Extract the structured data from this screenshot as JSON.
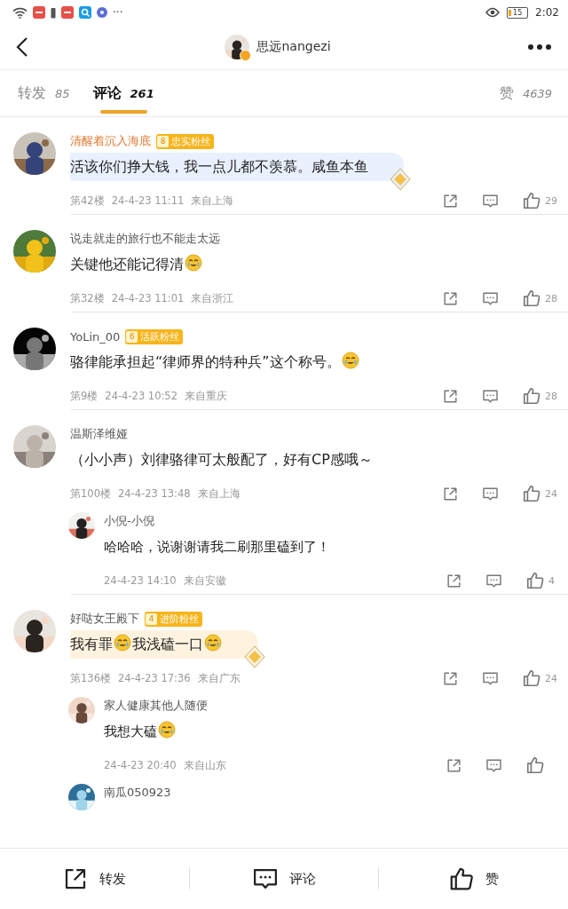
{
  "status_bar": {
    "more": "···",
    "battery": "15",
    "time": "2:02"
  },
  "header": {
    "title": "思远nangezi",
    "verified": true
  },
  "tabs": [
    {
      "label": "转发",
      "count": "85",
      "selected": false
    },
    {
      "label": "评论",
      "count": "261",
      "selected": true
    },
    {
      "label": "赞",
      "count": "4639",
      "selected": false
    }
  ],
  "comments": [
    {
      "kind": "comment",
      "name": "清醒着沉入海底",
      "vip": true,
      "badge": {
        "level": "8",
        "label": "忠实粉丝"
      },
      "color": "#e9f1ff",
      "content": [
        {
          "kind": "text",
          "text": "活该你们挣大钱，我一点儿都不羡慕。咸鱼本鱼"
        }
      ],
      "floor": "第42楼",
      "time": "24-4-23 11:11",
      "location": "来自上海",
      "likes": "29"
    },
    {
      "kind": "comment",
      "name": "说走就走的旅行也不能走太远",
      "vip": false,
      "content": [
        {
          "kind": "text",
          "text": "关键他还能记得清"
        },
        {
          "kind": "emoji"
        }
      ],
      "floor": "第32楼",
      "time": "24-4-23 11:01",
      "location": "来自浙江",
      "likes": "28"
    },
    {
      "kind": "comment",
      "name": "YoLin_00",
      "vip": false,
      "badge": {
        "level": "6",
        "label": "活跃粉丝"
      },
      "content": [
        {
          "kind": "text",
          "text": "骆律能承担起“律师界的特种兵”这个称号。"
        },
        {
          "kind": "emoji"
        }
      ],
      "floor": "第9楼",
      "time": "24-4-23 10:52",
      "location": "来自重庆",
      "likes": "28"
    },
    {
      "kind": "comment",
      "name": "温斯泽维娅",
      "vip": false,
      "content": [
        {
          "kind": "text",
          "text": "（小小声）刘律骆律可太般配了，好有CP感哦～"
        }
      ],
      "floor": "第100楼",
      "time": "24-4-23 13:48",
      "location": "来自上海",
      "likes": "24"
    },
    {
      "kind": "reply",
      "name": "小倪-小倪",
      "vip": false,
      "content": [
        {
          "kind": "text",
          "text": "哈哈哈，说谢谢请我二刷那里磕到了！"
        }
      ],
      "time": "24-4-23 14:10",
      "location": "来自安徽",
      "likes": "4"
    },
    {
      "kind": "comment",
      "name": "好哒女王殿下",
      "vip": false,
      "badge": {
        "level": "4",
        "label": "进阶粉丝"
      },
      "color": "#fff3e0",
      "content": [
        {
          "kind": "text",
          "text": "我有罪"
        },
        {
          "kind": "emoji"
        },
        {
          "kind": "text",
          "text": "我浅磕一口"
        },
        {
          "kind": "emoji"
        }
      ],
      "floor": "第136楼",
      "time": "24-4-23 17:36",
      "location": "来自广东",
      "likes": "24"
    },
    {
      "kind": "reply",
      "name": "家人健康其他人随便",
      "vip": false,
      "content": [
        {
          "kind": "text",
          "text": "我想大磕"
        },
        {
          "kind": "emoji"
        }
      ],
      "time": "24-4-23 20:40",
      "location": "来自山东"
    },
    {
      "kind": "reply",
      "name": "南瓜050923",
      "vip": false
    }
  ],
  "bottom_bar": [
    {
      "kind": "share",
      "label": "转发"
    },
    {
      "kind": "comment",
      "label": "评论"
    },
    {
      "kind": "like",
      "label": "赞"
    }
  ]
}
